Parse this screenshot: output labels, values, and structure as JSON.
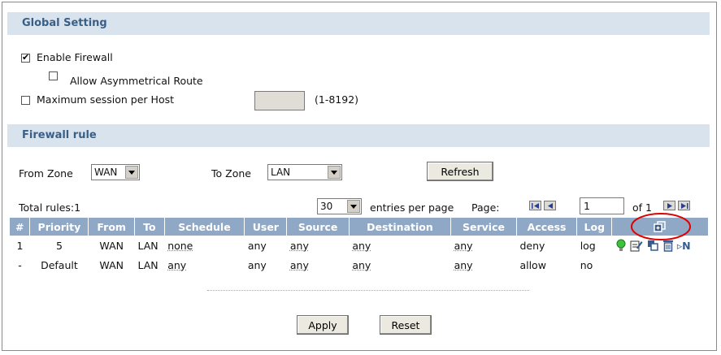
{
  "global": {
    "title": "Global Setting",
    "enable_firewall": "Enable Firewall",
    "allow_asym": "Allow Asymmetrical Route",
    "max_session": "Maximum session per Host",
    "max_session_range": "(1-8192)"
  },
  "rule": {
    "title": "Firewall rule",
    "from_zone_label": "From Zone",
    "from_zone_value": "WAN",
    "to_zone_label": "To Zone",
    "to_zone_value": "LAN",
    "refresh": "Refresh",
    "total_rules": "Total rules:1",
    "entries_value": "30",
    "entries_label": "entries per page",
    "page_label": "Page:",
    "page_value": "1",
    "of_label": "of 1"
  },
  "table": {
    "headers": [
      "#",
      "Priority",
      "From",
      "To",
      "Schedule",
      "User",
      "Source",
      "Destination",
      "Service",
      "Access",
      "Log"
    ],
    "rows": [
      [
        "1",
        "5",
        "WAN",
        "LAN",
        "none",
        "any",
        "any",
        "any",
        "any",
        "deny",
        "log"
      ],
      [
        "-",
        "Default",
        "WAN",
        "LAN",
        "any",
        "any",
        "any",
        "any",
        "any",
        "allow",
        "no"
      ]
    ],
    "icon_n": "N"
  },
  "footer": {
    "apply": "Apply",
    "reset": "Reset"
  },
  "colors": {
    "section_bg": "#d9e3ee",
    "section_text": "#3a5f86",
    "header_bg": "#8fa8c6",
    "highlight_ring": "#e00000"
  }
}
